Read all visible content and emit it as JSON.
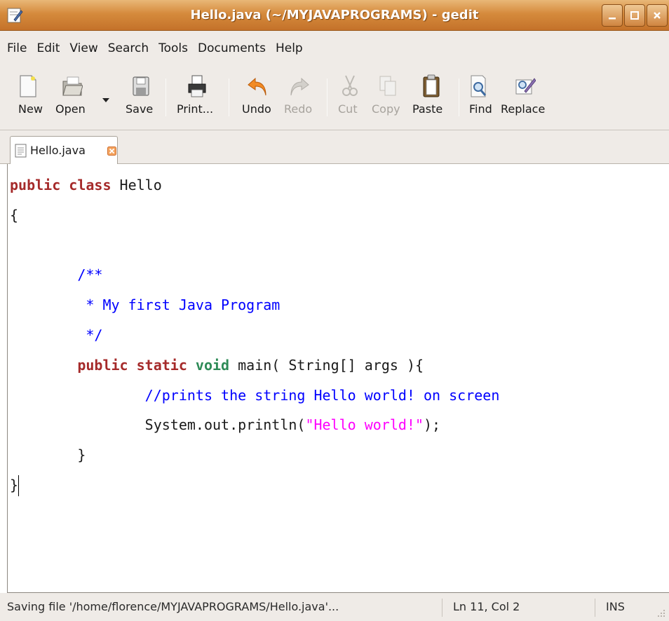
{
  "window": {
    "title": "Hello.java (~/MYJAVAPROGRAMS) - gedit",
    "app_icon": "gedit-icon",
    "controls": [
      "minimize-icon",
      "maximize-icon",
      "close-icon"
    ]
  },
  "menubar": {
    "items": [
      "File",
      "Edit",
      "View",
      "Search",
      "Tools",
      "Documents",
      "Help"
    ]
  },
  "toolbar": {
    "new": {
      "label": "New",
      "icon": "new-document-icon"
    },
    "open": {
      "label": "Open",
      "icon": "folder-open-icon"
    },
    "save": {
      "label": "Save",
      "icon": "floppy-disk-icon"
    },
    "print": {
      "label": "Print...",
      "icon": "printer-icon"
    },
    "undo": {
      "label": "Undo",
      "icon": "undo-arrow-icon"
    },
    "redo": {
      "label": "Redo",
      "icon": "redo-arrow-icon"
    },
    "cut": {
      "label": "Cut",
      "icon": "scissors-icon"
    },
    "copy": {
      "label": "Copy",
      "icon": "copy-icon"
    },
    "paste": {
      "label": "Paste",
      "icon": "clipboard-icon"
    },
    "find": {
      "label": "Find",
      "icon": "find-magnifier-icon"
    },
    "replace": {
      "label": "Replace",
      "icon": "replace-pencil-icon"
    }
  },
  "tab": {
    "label": "Hello.java",
    "icon": "text-file-icon",
    "close_icon": "tab-close-icon"
  },
  "editor": {
    "lines": [
      "public class Hello",
      "{",
      "",
      "        /**",
      "         * My first Java Program",
      "         */",
      "        public static void main( String[] args ){",
      "                //prints the string Hello world! on screen",
      "                System.out.println(\"Hello world!\");",
      "        }",
      "}"
    ],
    "colors": {
      "keyword": "#a52a2a",
      "type": "#2e8b57",
      "comment": "#0000ff",
      "string": "#ff00ff"
    }
  },
  "statusbar": {
    "message": "Saving file '/home/florence/MYJAVAPROGRAMS/Hello.java'...",
    "position": "Ln 11, Col 2",
    "mode": "INS"
  }
}
